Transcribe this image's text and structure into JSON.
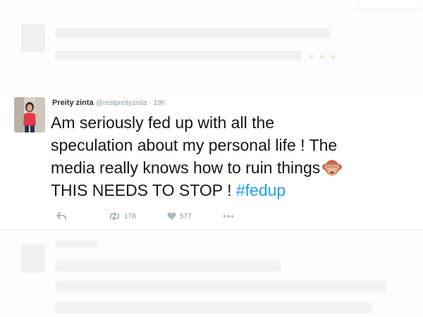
{
  "tweet": {
    "author_name": "Preity zinta",
    "handle": "@realpreityzinta",
    "separator": "·",
    "time": "19h",
    "text_line1": "Am seriously fed up with all the",
    "text_line2": "speculation about my personal life ! The",
    "text_line3": "media really knows how to ruin things",
    "text_line4": "THIS NEEDS TO STOP ! ",
    "hashtag": "#fedup",
    "emoji": "see-no-evil-monkey-icon",
    "retweets": "178",
    "likes": "577"
  },
  "icons": {
    "reply": "reply-icon",
    "retweet": "retweet-icon",
    "like": "heart-icon",
    "more": "more-icon"
  },
  "colors": {
    "text": "#14171a",
    "hashtag": "#1da1f2",
    "meta": "#8899a6",
    "action_icon": "#aab8c2",
    "divider": "#e6ecf0"
  }
}
